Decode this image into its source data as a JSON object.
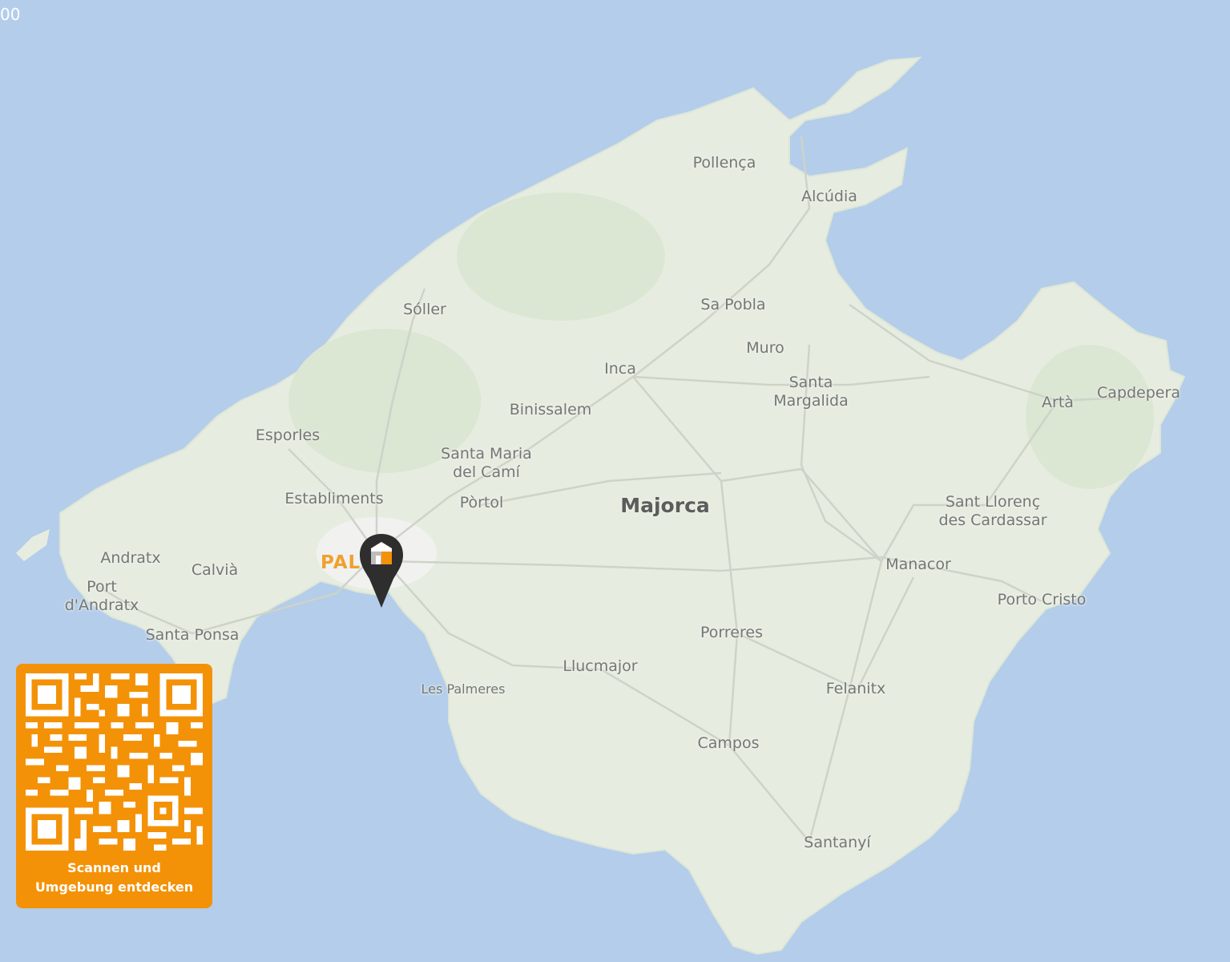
{
  "corner_text": "00",
  "region": "Majorca",
  "capital": "PAL",
  "places": {
    "pollenca": "Pollença",
    "alcudia": "Alcúdia",
    "soller": "Sóller",
    "sa_pobla": "Sa Pobla",
    "muro": "Muro",
    "inca": "Inca",
    "santa_margalida": [
      "Santa",
      "Margalida"
    ],
    "binissalem": "Binissalem",
    "arta": "Artà",
    "capdepera": "Capdepera",
    "esporles": "Esporles",
    "santa_maria": [
      "Santa Maria",
      "del Camí"
    ],
    "establiments": "Establiments",
    "portol": "Pòrtol",
    "sant_llorenc": [
      "Sant Llorenç",
      "des Cardassar"
    ],
    "andratx": "Andratx",
    "calvia": "Calvià",
    "manacor": "Manacor",
    "port_andratx": [
      "Port",
      "d'Andratx"
    ],
    "porto_cristo": "Porto Cristo",
    "santa_ponsa": "Santa Ponsa",
    "porreres": "Porreres",
    "llucmajor": "Llucmajor",
    "les_palmeres": "Les Palmeres",
    "felanitx": "Felanitx",
    "campos": "Campos",
    "santanyi": "Santanyí"
  },
  "qr_card": {
    "caption_line1": "Scannen und",
    "caption_line2": "Umgebung entdecken"
  },
  "icons": {
    "marker": "location-pin-icon",
    "marker_logo": "house-logo-icon",
    "qr": "qr-code-icon"
  },
  "colors": {
    "sea": "#b3cdeb",
    "land": "#e6ede0",
    "accent": "#f39207",
    "marker": "#2e2e2e"
  }
}
